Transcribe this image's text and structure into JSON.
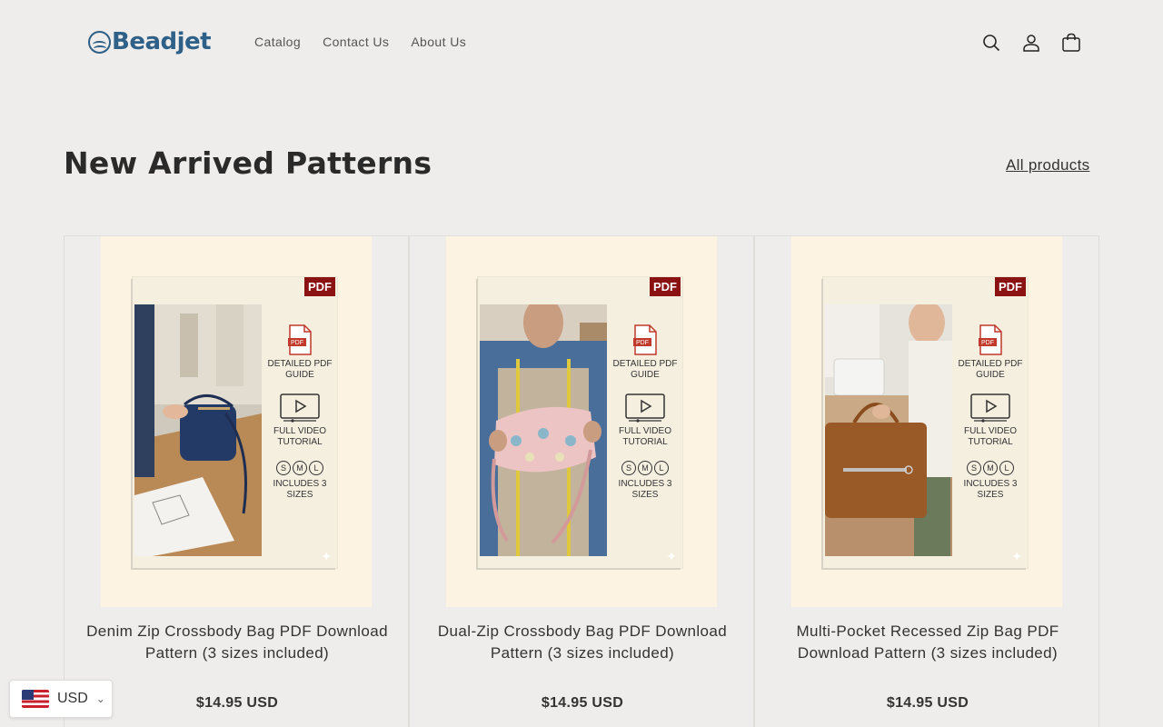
{
  "brand": {
    "name": "Beadjet"
  },
  "nav": [
    {
      "label": "Catalog"
    },
    {
      "label": "Contact Us"
    },
    {
      "label": "About Us"
    }
  ],
  "header_icons": [
    "search-icon",
    "account-icon",
    "cart-icon"
  ],
  "section": {
    "title": "New Arrived Patterns",
    "link": "All products"
  },
  "product_image_text": {
    "pdf_tag": "PDF",
    "feature_guide": "DETAILED PDF GUIDE",
    "feature_video": "FULL VIDEO TUTORIAL",
    "sizes": [
      "S",
      "M",
      "L"
    ],
    "feature_sizes": "INCLUDES 3 SIZES"
  },
  "products": [
    {
      "title": "Denim Zip Crossbody Bag PDF Download Pattern (3 sizes included)",
      "price": "$14.95 USD"
    },
    {
      "title": "Dual-Zip Crossbody Bag PDF Download Pattern (3 sizes included)",
      "price": "$14.95 USD"
    },
    {
      "title": "Multi-Pocket Recessed Zip Bag PDF Download Pattern (3 sizes included)",
      "price": "$14.95 USD"
    }
  ],
  "currency": {
    "code": "USD"
  },
  "colors": {
    "brand": "#2e6088",
    "background": "#efedeb",
    "pdf_tag": "#8b1212",
    "card_image_bg": "#fdf3e2"
  }
}
